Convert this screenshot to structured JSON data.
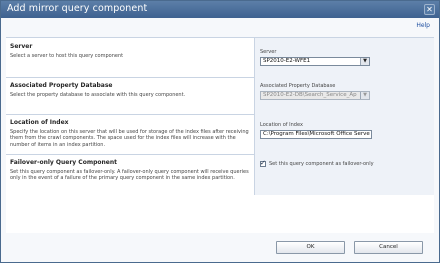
{
  "dialog": {
    "title": "Add mirror query component",
    "close_glyph": "✕",
    "help_label": "Help"
  },
  "sections": {
    "server": {
      "title": "Server",
      "description": "Select a server to host this query component",
      "field_label": "Server",
      "selected": "SP2010-E2-WFE1"
    },
    "database": {
      "title": "Associated Property Database",
      "description": "Select the property database to associate with this query component.",
      "field_label": "Associated Property Database",
      "selected": "SP2010-E2-DB\\Search_Service_Ap"
    },
    "location": {
      "title": "Location of Index",
      "description": "Specify the location on this server that will be used for storage of the index files after receiving them from the crawl components. The space used for the index files will increase with the number of items in an index partition.",
      "field_label": "Location of Index",
      "value": "C:\\Program Files\\Microsoft Office Serve"
    },
    "failover": {
      "title": "Failover-only Query Component",
      "description": "Set this query component as failover-only. A failover-only query component will receive queries only in the event of a failure of the primary query component in the same index partition.",
      "checkbox_label": "Set this query component as failover-only",
      "checked": true
    }
  },
  "buttons": {
    "ok": "OK",
    "cancel": "Cancel"
  },
  "icons": {
    "dropdown": "▼"
  },
  "colors": {
    "titlebar": "#4a6e9a",
    "section_border": "#c9d4e3",
    "field_panel": "#eef2f8",
    "link": "#1f4fa0"
  }
}
